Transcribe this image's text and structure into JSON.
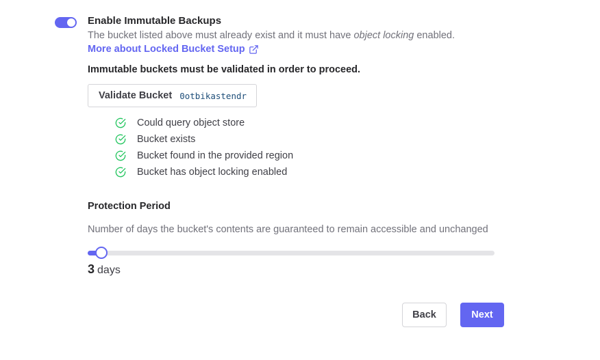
{
  "immutable": {
    "toggle_state": "on",
    "title": "Enable Immutable Backups",
    "description_prefix": "The bucket listed above must already exist and it must have ",
    "description_emphasis": "object locking",
    "description_suffix": " enabled.",
    "link_label": "More about Locked Bucket Setup",
    "link_icon": "external-link-icon",
    "validation_note": "Immutable buckets must be validated in order to proceed."
  },
  "validate": {
    "button_label": "Validate Bucket",
    "bucket_name": "0otbikastendr"
  },
  "checks": [
    {
      "label": "Could query object store",
      "icon": "check-circle-icon",
      "status": "success"
    },
    {
      "label": "Bucket exists",
      "icon": "check-circle-icon",
      "status": "success"
    },
    {
      "label": "Bucket found in the provided region",
      "icon": "check-circle-icon",
      "status": "success"
    },
    {
      "label": "Bucket has object locking enabled",
      "icon": "check-circle-icon",
      "status": "success"
    }
  ],
  "protection": {
    "title": "Protection Period",
    "description": "Number of days the bucket's contents are guaranteed to remain accessible and unchanged",
    "value": "3",
    "unit": "days",
    "slider_fill_fraction": 0.035
  },
  "footer": {
    "back_label": "Back",
    "next_label": "Next"
  },
  "colors": {
    "accent": "#6366f1",
    "success": "#22c55e",
    "text": "#3f3f46",
    "muted": "#71717a"
  }
}
